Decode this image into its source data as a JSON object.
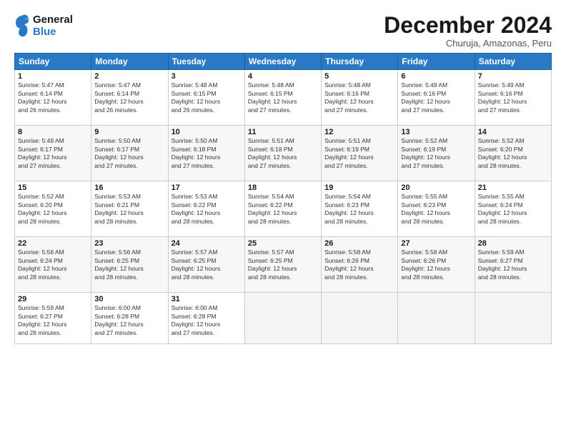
{
  "logo": {
    "line1": "General",
    "line2": "Blue"
  },
  "title": "December 2024",
  "subtitle": "Churuja, Amazonas, Peru",
  "weekdays": [
    "Sunday",
    "Monday",
    "Tuesday",
    "Wednesday",
    "Thursday",
    "Friday",
    "Saturday"
  ],
  "weeks": [
    [
      {
        "day": "1",
        "info": "Sunrise: 5:47 AM\nSunset: 6:14 PM\nDaylight: 12 hours\nand 26 minutes."
      },
      {
        "day": "2",
        "info": "Sunrise: 5:47 AM\nSunset: 6:14 PM\nDaylight: 12 hours\nand 26 minutes."
      },
      {
        "day": "3",
        "info": "Sunrise: 5:48 AM\nSunset: 6:15 PM\nDaylight: 12 hours\nand 26 minutes."
      },
      {
        "day": "4",
        "info": "Sunrise: 5:48 AM\nSunset: 6:15 PM\nDaylight: 12 hours\nand 27 minutes."
      },
      {
        "day": "5",
        "info": "Sunrise: 5:48 AM\nSunset: 6:16 PM\nDaylight: 12 hours\nand 27 minutes."
      },
      {
        "day": "6",
        "info": "Sunrise: 5:49 AM\nSunset: 6:16 PM\nDaylight: 12 hours\nand 27 minutes."
      },
      {
        "day": "7",
        "info": "Sunrise: 5:49 AM\nSunset: 6:16 PM\nDaylight: 12 hours\nand 27 minutes."
      }
    ],
    [
      {
        "day": "8",
        "info": "Sunrise: 5:49 AM\nSunset: 6:17 PM\nDaylight: 12 hours\nand 27 minutes."
      },
      {
        "day": "9",
        "info": "Sunrise: 5:50 AM\nSunset: 6:17 PM\nDaylight: 12 hours\nand 27 minutes."
      },
      {
        "day": "10",
        "info": "Sunrise: 5:50 AM\nSunset: 6:18 PM\nDaylight: 12 hours\nand 27 minutes."
      },
      {
        "day": "11",
        "info": "Sunrise: 5:51 AM\nSunset: 6:18 PM\nDaylight: 12 hours\nand 27 minutes."
      },
      {
        "day": "12",
        "info": "Sunrise: 5:51 AM\nSunset: 6:19 PM\nDaylight: 12 hours\nand 27 minutes."
      },
      {
        "day": "13",
        "info": "Sunrise: 5:52 AM\nSunset: 6:19 PM\nDaylight: 12 hours\nand 27 minutes."
      },
      {
        "day": "14",
        "info": "Sunrise: 5:52 AM\nSunset: 6:20 PM\nDaylight: 12 hours\nand 28 minutes."
      }
    ],
    [
      {
        "day": "15",
        "info": "Sunrise: 5:52 AM\nSunset: 6:20 PM\nDaylight: 12 hours\nand 28 minutes."
      },
      {
        "day": "16",
        "info": "Sunrise: 5:53 AM\nSunset: 6:21 PM\nDaylight: 12 hours\nand 28 minutes."
      },
      {
        "day": "17",
        "info": "Sunrise: 5:53 AM\nSunset: 6:22 PM\nDaylight: 12 hours\nand 28 minutes."
      },
      {
        "day": "18",
        "info": "Sunrise: 5:54 AM\nSunset: 6:22 PM\nDaylight: 12 hours\nand 28 minutes."
      },
      {
        "day": "19",
        "info": "Sunrise: 5:54 AM\nSunset: 6:23 PM\nDaylight: 12 hours\nand 28 minutes."
      },
      {
        "day": "20",
        "info": "Sunrise: 5:55 AM\nSunset: 6:23 PM\nDaylight: 12 hours\nand 28 minutes."
      },
      {
        "day": "21",
        "info": "Sunrise: 5:55 AM\nSunset: 6:24 PM\nDaylight: 12 hours\nand 28 minutes."
      }
    ],
    [
      {
        "day": "22",
        "info": "Sunrise: 5:56 AM\nSunset: 6:24 PM\nDaylight: 12 hours\nand 28 minutes."
      },
      {
        "day": "23",
        "info": "Sunrise: 5:56 AM\nSunset: 6:25 PM\nDaylight: 12 hours\nand 28 minutes."
      },
      {
        "day": "24",
        "info": "Sunrise: 5:57 AM\nSunset: 6:25 PM\nDaylight: 12 hours\nand 28 minutes."
      },
      {
        "day": "25",
        "info": "Sunrise: 5:57 AM\nSunset: 6:25 PM\nDaylight: 12 hours\nand 28 minutes."
      },
      {
        "day": "26",
        "info": "Sunrise: 5:58 AM\nSunset: 6:26 PM\nDaylight: 12 hours\nand 28 minutes."
      },
      {
        "day": "27",
        "info": "Sunrise: 5:58 AM\nSunset: 6:26 PM\nDaylight: 12 hours\nand 28 minutes."
      },
      {
        "day": "28",
        "info": "Sunrise: 5:59 AM\nSunset: 6:27 PM\nDaylight: 12 hours\nand 28 minutes."
      }
    ],
    [
      {
        "day": "29",
        "info": "Sunrise: 5:59 AM\nSunset: 6:27 PM\nDaylight: 12 hours\nand 28 minutes."
      },
      {
        "day": "30",
        "info": "Sunrise: 6:00 AM\nSunset: 6:28 PM\nDaylight: 12 hours\nand 27 minutes."
      },
      {
        "day": "31",
        "info": "Sunrise: 6:00 AM\nSunset: 6:28 PM\nDaylight: 12 hours\nand 27 minutes."
      },
      {
        "day": "",
        "info": ""
      },
      {
        "day": "",
        "info": ""
      },
      {
        "day": "",
        "info": ""
      },
      {
        "day": "",
        "info": ""
      }
    ]
  ]
}
